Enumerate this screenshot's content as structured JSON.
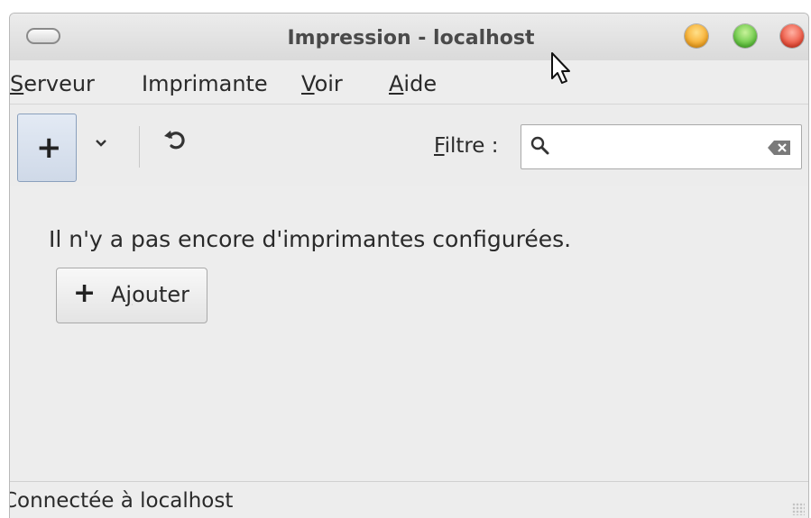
{
  "window": {
    "title": "Impression - localhost"
  },
  "menubar": {
    "items": [
      {
        "label_underlined": "S",
        "label_rest": "erveur"
      },
      {
        "label_underlined": "",
        "label_rest": "Imprimante"
      },
      {
        "label_underlined": "V",
        "label_rest": "oir"
      },
      {
        "label_underlined": "A",
        "label_rest": "ide"
      }
    ]
  },
  "toolbar": {
    "add_icon": "+",
    "dropdown_icon": "⌄",
    "refresh_icon": "↺",
    "filter_label_underlined": "F",
    "filter_label_rest": "iltre :",
    "filter_value": "",
    "filter_placeholder": ""
  },
  "content": {
    "empty_message": "Il n'y a pas encore d'imprimantes configurées.",
    "add_button_icon": "+",
    "add_button_label_pre": "A",
    "add_button_label_underlined": "j",
    "add_button_label_post": "outer"
  },
  "statusbar": {
    "text": "Connectée à localhost"
  },
  "colors": {
    "window_bg": "#ededed",
    "close_button": "#ea4a35",
    "maximize_button": "#5cc23a",
    "minimize_button": "#f6a623",
    "toolbar_active": "#cfd9e8"
  },
  "icons": {
    "window_menu": "window-menu-icon",
    "search": "search-icon",
    "clear": "clear-text-icon",
    "add": "plus-icon",
    "refresh": "refresh-icon",
    "dropdown": "chevron-down-icon",
    "cursor": "mouse-pointer-icon"
  }
}
